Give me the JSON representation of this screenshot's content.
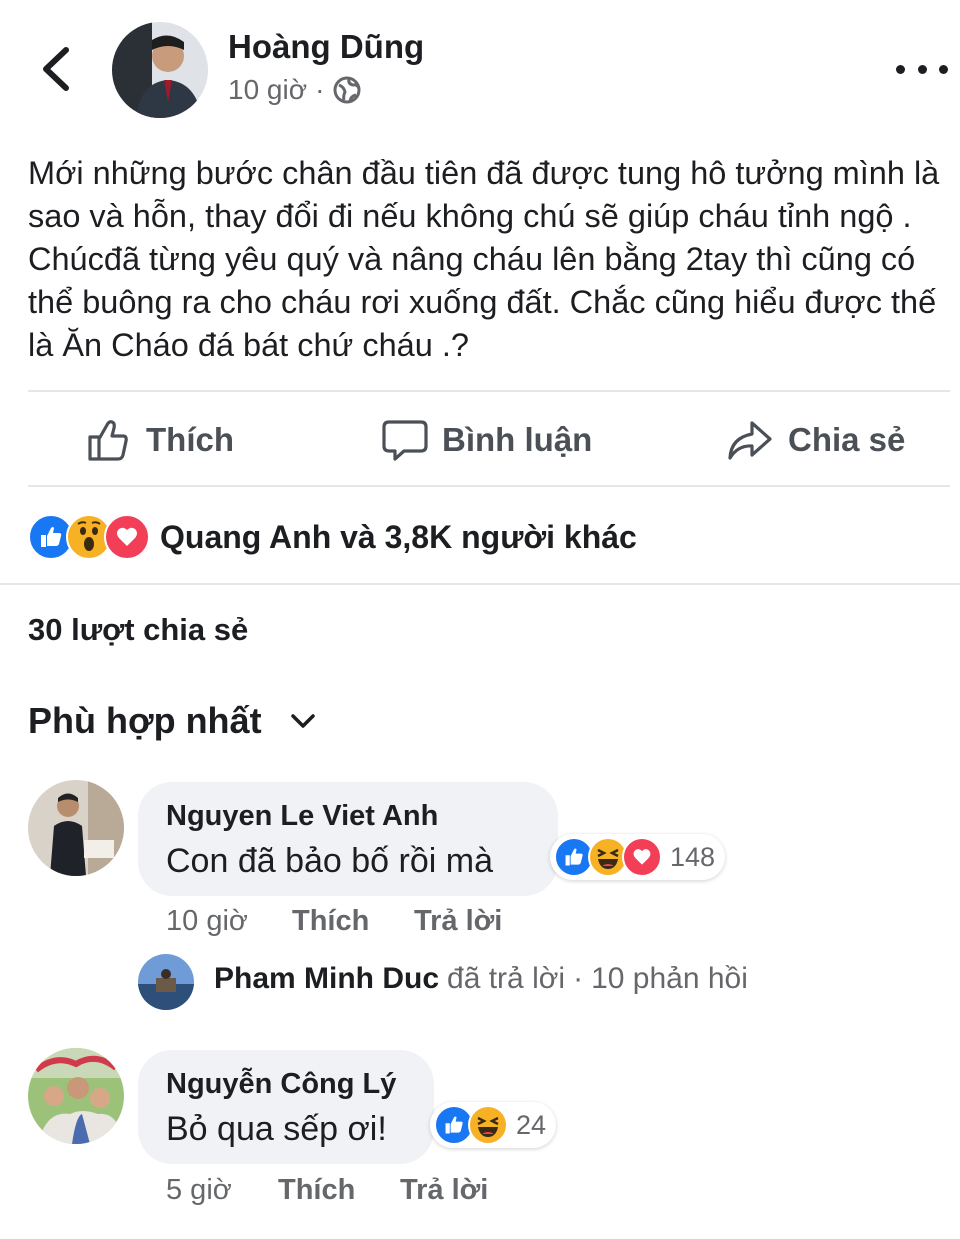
{
  "post": {
    "author": "Hoàng Dũng",
    "time": "10 giờ",
    "meta_separator": "·",
    "privacy_icon": "globe-icon",
    "text": "Mới những bước chân đầu tiên đã được tung hô tưởng mình là sao và hỗn, thay đổi đi nếu không chú sẽ giúp cháu tỉnh ngộ . Chúcđã từng yêu quý và nâng cháu lên bằng 2tay thì cũng có thể buông ra cho cháu rơi xuống đất. Chắc cũng hiểu được thế là Ăn Cháo đá bát chứ cháu .?"
  },
  "actions": {
    "like": "Thích",
    "comment": "Bình luận",
    "share": "Chia sẻ"
  },
  "reactions": {
    "summary": "Quang Anh và 3,8K người khác",
    "icons": [
      "like-icon",
      "wow-icon",
      "love-icon"
    ],
    "colors": {
      "like": "#1877f2",
      "love": "#f33e58",
      "wow": "#f7b125"
    }
  },
  "shares_count": "30 lượt chia sẻ",
  "sort_label": "Phù hợp nhất",
  "comments": [
    {
      "name": "Nguyen Le Viet Anh",
      "text": "Con đã bảo bố rồi mà",
      "reaction_count": "148",
      "reaction_icons": [
        "like-icon",
        "haha-icon",
        "love-icon"
      ],
      "time": "10 giờ",
      "like_label": "Thích",
      "reply_label": "Trả lời",
      "reply_preview": {
        "name": "Pham Minh Duc",
        "action": "đã trả lời",
        "separator": "·",
        "count": "10 phản hồi"
      }
    },
    {
      "name": "Nguyễn Công Lý",
      "text": "Bỏ qua sếp ơi!",
      "reaction_count": "24",
      "reaction_icons": [
        "like-icon",
        "haha-icon"
      ],
      "time": "5 giờ",
      "like_label": "Thích",
      "reply_label": "Trả lời"
    }
  ]
}
